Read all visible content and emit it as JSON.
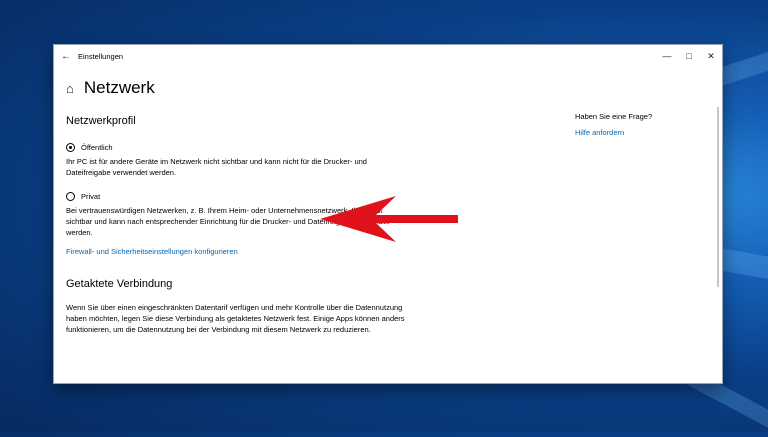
{
  "window": {
    "title": "Einstellungen",
    "back_icon": "arrow-left-icon",
    "controls": [
      "minimize",
      "maximize",
      "close"
    ]
  },
  "page": {
    "title": "Netzwerk",
    "home_icon": "home-icon"
  },
  "network_profile": {
    "heading": "Netzwerkprofil",
    "public": {
      "label": "Öffentlich",
      "selected": true,
      "description": "Ihr PC ist für andere Geräte im Netzwerk nicht sichtbar und kann nicht für die Drucker- und Dateifreigabe verwendet werden."
    },
    "private": {
      "label": "Privat",
      "selected": false,
      "description": "Bei vertrauenswürdigen Netzwerken, z. B. Ihrem Heim- oder Unternehmensnetzwerk. Ihr PC ist sichtbar und kann nach entsprechender Einrichtung für die Drucker- und Dateifreigabe verwendet werden."
    },
    "firewall_link": "Firewall- und Sicherheitseinstellungen konfigurieren"
  },
  "metered": {
    "heading": "Getaktete Verbindung",
    "description": "Wenn Sie über einen eingeschränkten Datentarif verfügen und mehr Kontrolle über die Datennutzung haben möchten, legen Sie diese Verbindung als getaktetes Netzwerk fest. Einige Apps können anders funktionieren, um die Datennutzung bei der Verbindung mit diesem Netzwerk zu reduzieren."
  },
  "help": {
    "question": "Haben Sie eine Frage?",
    "link": "Hilfe anfordern"
  },
  "colors": {
    "link": "#0067b8",
    "annotation_arrow": "#e0121b"
  }
}
